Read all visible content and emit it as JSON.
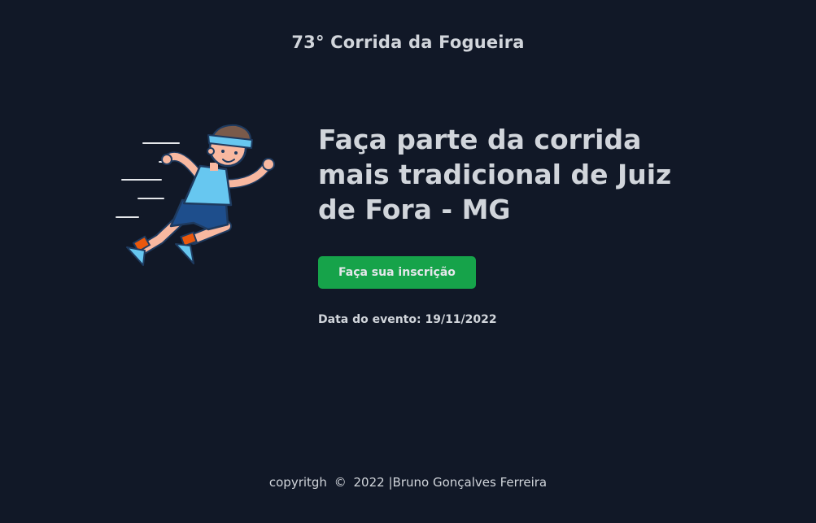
{
  "header": {
    "title": "73° Corrida da Fogueira"
  },
  "hero": {
    "illustration": "running-man",
    "headline": "Faça parte da corrida mais tradicional de Juiz de Fora - MG",
    "cta_label": "Faça sua inscrição",
    "event_date_label": "Data do evento:",
    "event_date": "19/11/2022"
  },
  "footer": {
    "copyright_word": "copyritgh",
    "copyright_symbol": "©",
    "year": "2022",
    "separator": "|",
    "author": "Bruno Gonçalves Ferreira"
  },
  "colors": {
    "background": "#111827",
    "text": "#d1d5db",
    "button": "#16a34a"
  }
}
